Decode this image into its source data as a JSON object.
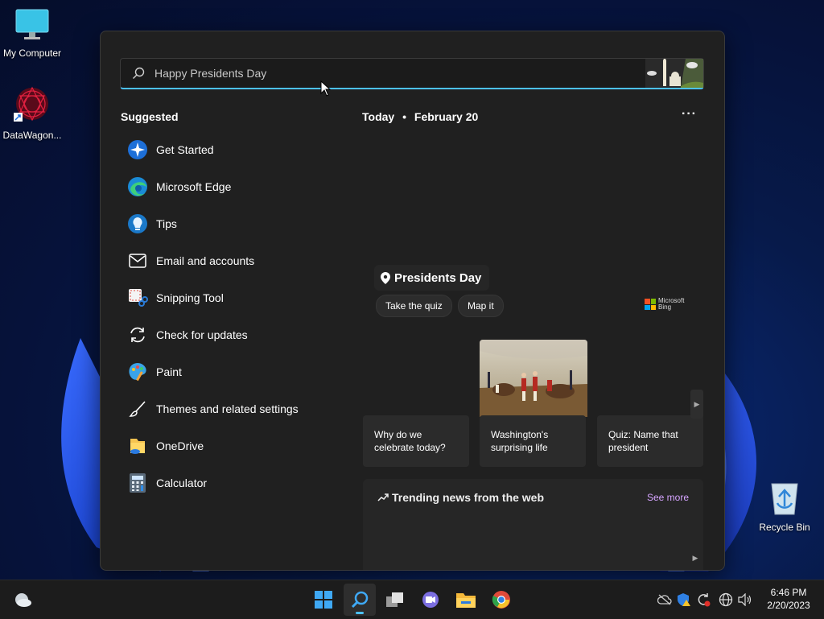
{
  "desktop": {
    "icons": [
      {
        "label": "My Computer",
        "icon": "monitor-icon"
      },
      {
        "label": "DataWagon...",
        "icon": "datawagon-icon"
      },
      {
        "label": "Recycle Bin",
        "icon": "recycle-bin-icon"
      }
    ]
  },
  "search": {
    "placeholder": "Happy Presidents Day",
    "doodle_icon": "presidents-day-doodle-icon"
  },
  "suggested": {
    "heading": "Suggested",
    "items": [
      {
        "label": "Get Started",
        "icon": "get-started-icon"
      },
      {
        "label": "Microsoft Edge",
        "icon": "edge-icon"
      },
      {
        "label": "Tips",
        "icon": "tips-icon"
      },
      {
        "label": "Email and accounts",
        "icon": "mail-icon"
      },
      {
        "label": "Snipping Tool",
        "icon": "snipping-tool-icon"
      },
      {
        "label": "Check for updates",
        "icon": "refresh-icon"
      },
      {
        "label": "Paint",
        "icon": "paint-icon"
      },
      {
        "label": "Themes and related settings",
        "icon": "brush-icon"
      },
      {
        "label": "OneDrive",
        "icon": "onedrive-icon"
      },
      {
        "label": "Calculator",
        "icon": "calculator-icon"
      }
    ]
  },
  "today": {
    "label": "Today",
    "separator": "•",
    "date": "February 20",
    "more": "···"
  },
  "highlight": {
    "title": "Presidents Day",
    "chips": [
      "Take the quiz",
      "Map it"
    ],
    "bing_line1": "Microsoft",
    "bing_line2": "Bing",
    "cards": [
      {
        "text": "Why do we celebrate today?"
      },
      {
        "text": "Washington's surprising life"
      },
      {
        "text": "Quiz: Name that president"
      }
    ]
  },
  "trending": {
    "title": "Trending news from the web",
    "see_more": "See more"
  },
  "taskbar": {
    "apps": [
      "start-icon",
      "search-icon",
      "task-view-icon",
      "teams-chat-icon",
      "file-explorer-icon",
      "chrome-icon"
    ],
    "time": "6:46 PM",
    "date": "2/20/2023"
  },
  "colors": {
    "accent": "#4cc2ff",
    "panel_bg": "#202020",
    "see_more": "#d5a4ff"
  }
}
